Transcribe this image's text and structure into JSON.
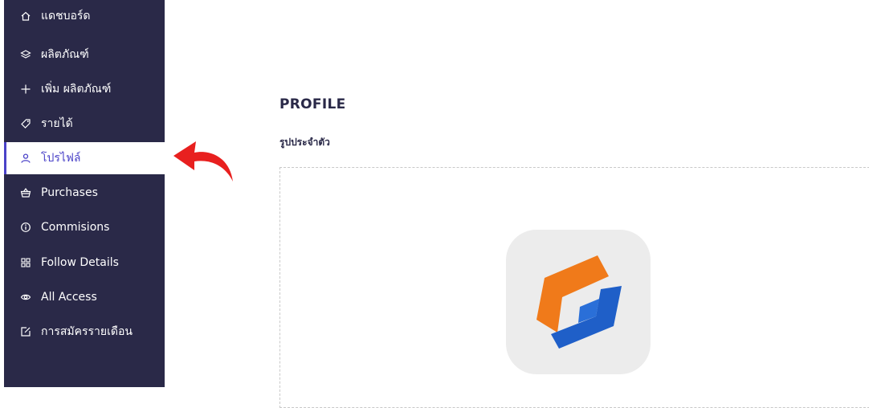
{
  "sidebar": {
    "items": [
      {
        "label": "แดชบอร์ด",
        "icon": "home-icon"
      },
      {
        "label": "ผลิตภัณฑ์",
        "icon": "layers-icon"
      },
      {
        "label": "เพิ่ม ผลิตภัณฑ์",
        "icon": "plus-icon"
      },
      {
        "label": "รายได้",
        "icon": "tag-icon"
      },
      {
        "label": "โปรไฟล์",
        "icon": "user-icon",
        "active": true
      },
      {
        "label": "Purchases",
        "icon": "basket-icon"
      },
      {
        "label": "Commisions",
        "icon": "info-icon"
      },
      {
        "label": "Follow Details",
        "icon": "grid-icon"
      },
      {
        "label": "All Access",
        "icon": "eye-icon"
      },
      {
        "label": "การสมัครรายเดือน",
        "icon": "edit-icon"
      }
    ]
  },
  "main": {
    "title": "PROFILE",
    "avatar_label": "รูปประจำตัว"
  },
  "colors": {
    "sidebar_bg": "#2a2948",
    "accent": "#4a42c8",
    "arrow": "#e8201f",
    "logo_orange": "#f07a1a",
    "logo_blue": "#1f5fc8"
  }
}
